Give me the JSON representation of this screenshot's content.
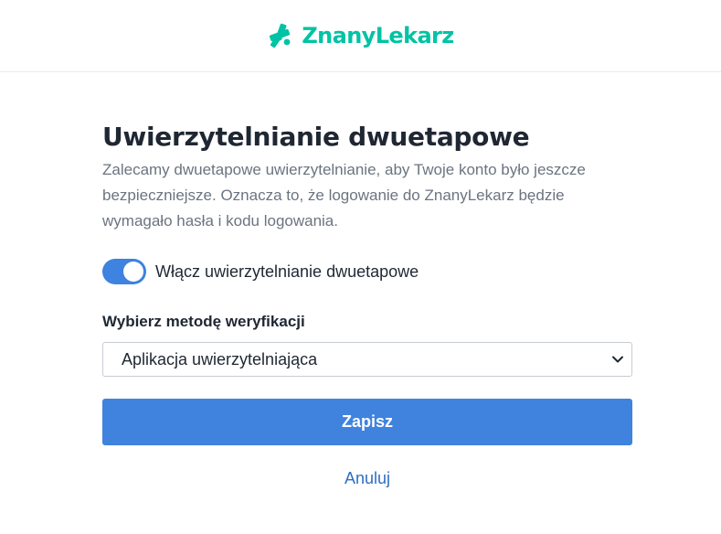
{
  "header": {
    "logo_text": "ZnanyLekarz",
    "logo_icon": "znanylekarz-logo-icon",
    "brand_color": "#00c3a5"
  },
  "page": {
    "title": "Uwierzytelnianie dwuetapowe",
    "description": "Zalecamy dwuetapowe uwierzytelnianie, aby Twoje konto było jeszcze bezpieczniejsze. Oznacza to, że logowanie do ZnanyLekarz będzie wymagało hasła i kodu logowania."
  },
  "toggle": {
    "label": "Włącz uwierzytelnianie dwuetapowe",
    "checked": true,
    "color": "#3d83df"
  },
  "method": {
    "label": "Wybierz metodę weryfikacji",
    "selected": "Aplikacja uwierzytelniająca",
    "caret_icon": "chevron-down-icon"
  },
  "actions": {
    "save_label": "Zapisz",
    "cancel_label": "Anuluj",
    "primary_color": "#3f83df",
    "link_color": "#2d6fc2"
  }
}
